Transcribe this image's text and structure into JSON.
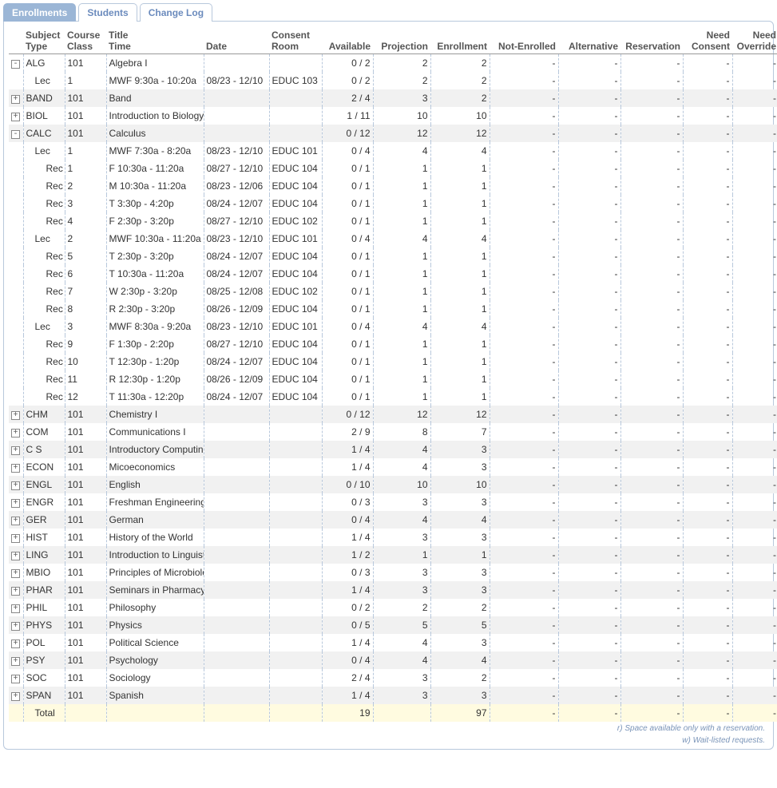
{
  "tabs": [
    {
      "label": "Enrollments",
      "active": true
    },
    {
      "label": "Students",
      "active": false
    },
    {
      "label": "Change Log",
      "active": false
    }
  ],
  "headers": {
    "subject": "Subject",
    "type": "Type",
    "course": "Course",
    "class": "Class",
    "title": "Title",
    "time": "Time",
    "date": "Date",
    "consent": "Consent",
    "room": "Room",
    "available": "Available",
    "projection": "Projection",
    "enrollment": "Enrollment",
    "notEnrolled": "Not-Enrolled",
    "alternative": "Alternative",
    "reservation": "Reservation",
    "needConsent1": "Need",
    "needConsent2": "Consent",
    "needOverride1": "Need",
    "needOverride2": "Override"
  },
  "rows": [
    {
      "shade": false,
      "exp": "minus",
      "ind": 0,
      "c1": "ALG",
      "c2": "101",
      "c3": "Algebra I",
      "c4": "",
      "c5": "",
      "avail": "0 / 2",
      "proj": "2",
      "enr": "2",
      "ne": "-",
      "alt": "-",
      "res": "-",
      "nc": "-",
      "no": "-"
    },
    {
      "shade": false,
      "exp": "",
      "ind": 1,
      "c1": "Lec",
      "c2": "1",
      "c3": "MWF 9:30a - 10:20a",
      "c4": "08/23 - 12/10",
      "c5": "EDUC 103",
      "avail": "0 / 2",
      "proj": "2",
      "enr": "2",
      "ne": "-",
      "alt": "-",
      "res": "-",
      "nc": "-",
      "no": "-"
    },
    {
      "shade": true,
      "exp": "plus",
      "ind": 0,
      "c1": "BAND",
      "c2": "101",
      "c3": "Band",
      "c4": "",
      "c5": "",
      "avail": "2 / 4",
      "proj": "3",
      "enr": "2",
      "ne": "-",
      "alt": "-",
      "res": "-",
      "nc": "-",
      "no": "-"
    },
    {
      "shade": false,
      "exp": "plus",
      "ind": 0,
      "c1": "BIOL",
      "c2": "101",
      "c3": "Introduction to Biology",
      "c4": "",
      "c5": "",
      "avail": "1 / 11",
      "proj": "10",
      "enr": "10",
      "ne": "-",
      "alt": "-",
      "res": "-",
      "nc": "-",
      "no": "-"
    },
    {
      "shade": true,
      "exp": "minus",
      "ind": 0,
      "c1": "CALC",
      "c2": "101",
      "c3": "Calculus",
      "c4": "",
      "c5": "",
      "avail": "0 / 12",
      "proj": "12",
      "enr": "12",
      "ne": "-",
      "alt": "-",
      "res": "-",
      "nc": "-",
      "no": "-"
    },
    {
      "shade": false,
      "exp": "",
      "ind": 1,
      "c1": "Lec",
      "c2": "1",
      "c3": "MWF 7:30a - 8:20a",
      "c4": "08/23 - 12/10",
      "c5": "EDUC 101",
      "avail": "0 / 4",
      "proj": "4",
      "enr": "4",
      "ne": "-",
      "alt": "-",
      "res": "-",
      "nc": "-",
      "no": "-"
    },
    {
      "shade": false,
      "exp": "",
      "ind": 2,
      "c1": "Rec",
      "c2": "1",
      "c3": "F 10:30a - 11:20a",
      "c4": "08/27 - 12/10",
      "c5": "EDUC 104",
      "avail": "0 / 1",
      "proj": "1",
      "enr": "1",
      "ne": "-",
      "alt": "-",
      "res": "-",
      "nc": "-",
      "no": "-"
    },
    {
      "shade": false,
      "exp": "",
      "ind": 2,
      "c1": "Rec",
      "c2": "2",
      "c3": "M 10:30a - 11:20a",
      "c4": "08/23 - 12/06",
      "c5": "EDUC 104",
      "avail": "0 / 1",
      "proj": "1",
      "enr": "1",
      "ne": "-",
      "alt": "-",
      "res": "-",
      "nc": "-",
      "no": "-"
    },
    {
      "shade": false,
      "exp": "",
      "ind": 2,
      "c1": "Rec",
      "c2": "3",
      "c3": "T 3:30p - 4:20p",
      "c4": "08/24 - 12/07",
      "c5": "EDUC 104",
      "avail": "0 / 1",
      "proj": "1",
      "enr": "1",
      "ne": "-",
      "alt": "-",
      "res": "-",
      "nc": "-",
      "no": "-"
    },
    {
      "shade": false,
      "exp": "",
      "ind": 2,
      "c1": "Rec",
      "c2": "4",
      "c3": "F 2:30p - 3:20p",
      "c4": "08/27 - 12/10",
      "c5": "EDUC 102",
      "avail": "0 / 1",
      "proj": "1",
      "enr": "1",
      "ne": "-",
      "alt": "-",
      "res": "-",
      "nc": "-",
      "no": "-"
    },
    {
      "shade": false,
      "exp": "",
      "ind": 1,
      "c1": "Lec",
      "c2": "2",
      "c3": "MWF 10:30a - 11:20a",
      "c4": "08/23 - 12/10",
      "c5": "EDUC 101",
      "avail": "0 / 4",
      "proj": "4",
      "enr": "4",
      "ne": "-",
      "alt": "-",
      "res": "-",
      "nc": "-",
      "no": "-"
    },
    {
      "shade": false,
      "exp": "",
      "ind": 2,
      "c1": "Rec",
      "c2": "5",
      "c3": "T 2:30p - 3:20p",
      "c4": "08/24 - 12/07",
      "c5": "EDUC 104",
      "avail": "0 / 1",
      "proj": "1",
      "enr": "1",
      "ne": "-",
      "alt": "-",
      "res": "-",
      "nc": "-",
      "no": "-"
    },
    {
      "shade": false,
      "exp": "",
      "ind": 2,
      "c1": "Rec",
      "c2": "6",
      "c3": "T 10:30a - 11:20a",
      "c4": "08/24 - 12/07",
      "c5": "EDUC 104",
      "avail": "0 / 1",
      "proj": "1",
      "enr": "1",
      "ne": "-",
      "alt": "-",
      "res": "-",
      "nc": "-",
      "no": "-"
    },
    {
      "shade": false,
      "exp": "",
      "ind": 2,
      "c1": "Rec",
      "c2": "7",
      "c3": "W 2:30p - 3:20p",
      "c4": "08/25 - 12/08",
      "c5": "EDUC 102",
      "avail": "0 / 1",
      "proj": "1",
      "enr": "1",
      "ne": "-",
      "alt": "-",
      "res": "-",
      "nc": "-",
      "no": "-"
    },
    {
      "shade": false,
      "exp": "",
      "ind": 2,
      "c1": "Rec",
      "c2": "8",
      "c3": "R 2:30p - 3:20p",
      "c4": "08/26 - 12/09",
      "c5": "EDUC 104",
      "avail": "0 / 1",
      "proj": "1",
      "enr": "1",
      "ne": "-",
      "alt": "-",
      "res": "-",
      "nc": "-",
      "no": "-"
    },
    {
      "shade": false,
      "exp": "",
      "ind": 1,
      "c1": "Lec",
      "c2": "3",
      "c3": "MWF 8:30a - 9:20a",
      "c4": "08/23 - 12/10",
      "c5": "EDUC 101",
      "avail": "0 / 4",
      "proj": "4",
      "enr": "4",
      "ne": "-",
      "alt": "-",
      "res": "-",
      "nc": "-",
      "no": "-"
    },
    {
      "shade": false,
      "exp": "",
      "ind": 2,
      "c1": "Rec",
      "c2": "9",
      "c3": "F 1:30p - 2:20p",
      "c4": "08/27 - 12/10",
      "c5": "EDUC 104",
      "avail": "0 / 1",
      "proj": "1",
      "enr": "1",
      "ne": "-",
      "alt": "-",
      "res": "-",
      "nc": "-",
      "no": "-"
    },
    {
      "shade": false,
      "exp": "",
      "ind": 2,
      "c1": "Rec",
      "c2": "10",
      "c3": "T 12:30p - 1:20p",
      "c4": "08/24 - 12/07",
      "c5": "EDUC 104",
      "avail": "0 / 1",
      "proj": "1",
      "enr": "1",
      "ne": "-",
      "alt": "-",
      "res": "-",
      "nc": "-",
      "no": "-"
    },
    {
      "shade": false,
      "exp": "",
      "ind": 2,
      "c1": "Rec",
      "c2": "11",
      "c3": "R 12:30p - 1:20p",
      "c4": "08/26 - 12/09",
      "c5": "EDUC 104",
      "avail": "0 / 1",
      "proj": "1",
      "enr": "1",
      "ne": "-",
      "alt": "-",
      "res": "-",
      "nc": "-",
      "no": "-"
    },
    {
      "shade": false,
      "exp": "",
      "ind": 2,
      "c1": "Rec",
      "c2": "12",
      "c3": "T 11:30a - 12:20p",
      "c4": "08/24 - 12/07",
      "c5": "EDUC 104",
      "avail": "0 / 1",
      "proj": "1",
      "enr": "1",
      "ne": "-",
      "alt": "-",
      "res": "-",
      "nc": "-",
      "no": "-"
    },
    {
      "shade": true,
      "exp": "plus",
      "ind": 0,
      "c1": "CHM",
      "c2": "101",
      "c3": "Chemistry I",
      "c4": "",
      "c5": "",
      "avail": "0 / 12",
      "proj": "12",
      "enr": "12",
      "ne": "-",
      "alt": "-",
      "res": "-",
      "nc": "-",
      "no": "-"
    },
    {
      "shade": false,
      "exp": "plus",
      "ind": 0,
      "c1": "COM",
      "c2": "101",
      "c3": "Communications I",
      "c4": "",
      "c5": "",
      "avail": "2 / 9",
      "proj": "8",
      "enr": "7",
      "ne": "-",
      "alt": "-",
      "res": "-",
      "nc": "-",
      "no": "-"
    },
    {
      "shade": true,
      "exp": "plus",
      "ind": 0,
      "c1": "C S",
      "c2": "101",
      "c3": "Introductory Computing",
      "c4": "",
      "c5": "",
      "avail": "1 / 4",
      "proj": "4",
      "enr": "3",
      "ne": "-",
      "alt": "-",
      "res": "-",
      "nc": "-",
      "no": "-"
    },
    {
      "shade": false,
      "exp": "plus",
      "ind": 0,
      "c1": "ECON",
      "c2": "101",
      "c3": "Micoeconomics",
      "c4": "",
      "c5": "",
      "avail": "1 / 4",
      "proj": "4",
      "enr": "3",
      "ne": "-",
      "alt": "-",
      "res": "-",
      "nc": "-",
      "no": "-"
    },
    {
      "shade": true,
      "exp": "plus",
      "ind": 0,
      "c1": "ENGL",
      "c2": "101",
      "c3": "English",
      "c4": "",
      "c5": "",
      "avail": "0 / 10",
      "proj": "10",
      "enr": "10",
      "ne": "-",
      "alt": "-",
      "res": "-",
      "nc": "-",
      "no": "-"
    },
    {
      "shade": false,
      "exp": "plus",
      "ind": 0,
      "c1": "ENGR",
      "c2": "101",
      "c3": "Freshman Engineering",
      "c4": "",
      "c5": "",
      "avail": "0 / 3",
      "proj": "3",
      "enr": "3",
      "ne": "-",
      "alt": "-",
      "res": "-",
      "nc": "-",
      "no": "-"
    },
    {
      "shade": true,
      "exp": "plus",
      "ind": 0,
      "c1": "GER",
      "c2": "101",
      "c3": "German",
      "c4": "",
      "c5": "",
      "avail": "0 / 4",
      "proj": "4",
      "enr": "4",
      "ne": "-",
      "alt": "-",
      "res": "-",
      "nc": "-",
      "no": "-"
    },
    {
      "shade": false,
      "exp": "plus",
      "ind": 0,
      "c1": "HIST",
      "c2": "101",
      "c3": "History of the World",
      "c4": "",
      "c5": "",
      "avail": "1 / 4",
      "proj": "3",
      "enr": "3",
      "ne": "-",
      "alt": "-",
      "res": "-",
      "nc": "-",
      "no": "-"
    },
    {
      "shade": true,
      "exp": "plus",
      "ind": 0,
      "c1": "LING",
      "c2": "101",
      "c3": "Introduction to Linguistics",
      "c4": "",
      "c5": "",
      "avail": "1 / 2",
      "proj": "1",
      "enr": "1",
      "ne": "-",
      "alt": "-",
      "res": "-",
      "nc": "-",
      "no": "-"
    },
    {
      "shade": false,
      "exp": "plus",
      "ind": 0,
      "c1": "MBIO",
      "c2": "101",
      "c3": "Principles of Microbiology",
      "c4": "",
      "c5": "",
      "avail": "0 / 3",
      "proj": "3",
      "enr": "3",
      "ne": "-",
      "alt": "-",
      "res": "-",
      "nc": "-",
      "no": "-"
    },
    {
      "shade": true,
      "exp": "plus",
      "ind": 0,
      "c1": "PHAR",
      "c2": "101",
      "c3": "Seminars in Pharmacy",
      "c4": "",
      "c5": "",
      "avail": "1 / 4",
      "proj": "3",
      "enr": "3",
      "ne": "-",
      "alt": "-",
      "res": "-",
      "nc": "-",
      "no": "-"
    },
    {
      "shade": false,
      "exp": "plus",
      "ind": 0,
      "c1": "PHIL",
      "c2": "101",
      "c3": "Philosophy",
      "c4": "",
      "c5": "",
      "avail": "0 / 2",
      "proj": "2",
      "enr": "2",
      "ne": "-",
      "alt": "-",
      "res": "-",
      "nc": "-",
      "no": "-"
    },
    {
      "shade": true,
      "exp": "plus",
      "ind": 0,
      "c1": "PHYS",
      "c2": "101",
      "c3": "Physics",
      "c4": "",
      "c5": "",
      "avail": "0 / 5",
      "proj": "5",
      "enr": "5",
      "ne": "-",
      "alt": "-",
      "res": "-",
      "nc": "-",
      "no": "-"
    },
    {
      "shade": false,
      "exp": "plus",
      "ind": 0,
      "c1": "POL",
      "c2": "101",
      "c3": "Political Science",
      "c4": "",
      "c5": "",
      "avail": "1 / 4",
      "proj": "4",
      "enr": "3",
      "ne": "-",
      "alt": "-",
      "res": "-",
      "nc": "-",
      "no": "-"
    },
    {
      "shade": true,
      "exp": "plus",
      "ind": 0,
      "c1": "PSY",
      "c2": "101",
      "c3": "Psychology",
      "c4": "",
      "c5": "",
      "avail": "0 / 4",
      "proj": "4",
      "enr": "4",
      "ne": "-",
      "alt": "-",
      "res": "-",
      "nc": "-",
      "no": "-"
    },
    {
      "shade": false,
      "exp": "plus",
      "ind": 0,
      "c1": "SOC",
      "c2": "101",
      "c3": "Sociology",
      "c4": "",
      "c5": "",
      "avail": "2 / 4",
      "proj": "3",
      "enr": "2",
      "ne": "-",
      "alt": "-",
      "res": "-",
      "nc": "-",
      "no": "-"
    },
    {
      "shade": true,
      "exp": "plus",
      "ind": 0,
      "c1": "SPAN",
      "c2": "101",
      "c3": "Spanish",
      "c4": "",
      "c5": "",
      "avail": "1 / 4",
      "proj": "3",
      "enr": "3",
      "ne": "-",
      "alt": "-",
      "res": "-",
      "nc": "-",
      "no": "-"
    }
  ],
  "total": {
    "label": "Total",
    "avail": "19",
    "proj": "",
    "enr": "97",
    "ne": "-",
    "alt": "-",
    "res": "-",
    "nc": "-",
    "no": "-"
  },
  "footnotes": {
    "r": "r) Space available only with a reservation.",
    "w": "w) Wait-listed requests."
  }
}
